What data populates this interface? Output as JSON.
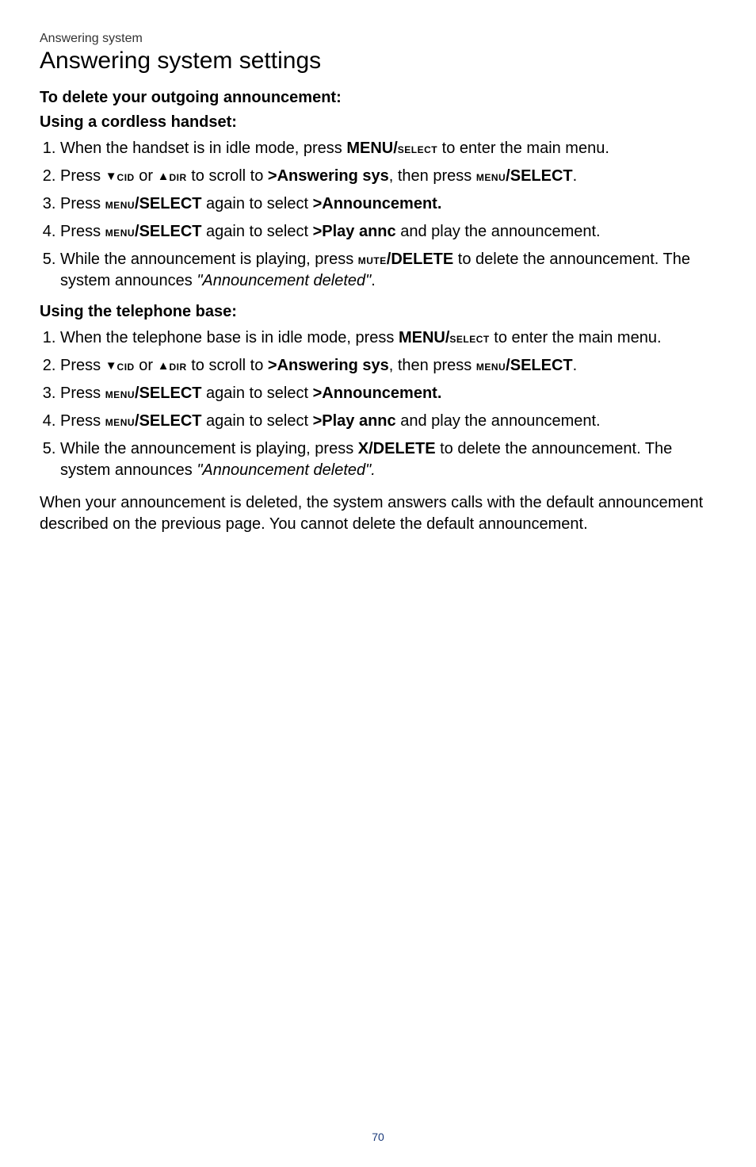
{
  "breadcrumb": "Answering system",
  "title": "Answering system settings",
  "heading1": "To delete your outgoing announcement:",
  "sub1": "Using a cordless handset:",
  "list1": {
    "i1a": "When the handset is in idle mode, press ",
    "i1b": "MENU/",
    "i1c": "select",
    "i1d": " to enter the main menu.",
    "i2a": "Press ",
    "i2b": "cid",
    "i2c": " or ",
    "i2d": "dir",
    "i2e": " to scroll to ",
    "i2f": ">Answering sys",
    "i2g": ", then press ",
    "i2h": "menu",
    "i2i": "/SELECT",
    "i2j": ".",
    "i3a": "Press ",
    "i3b": "menu",
    "i3c": "/SELECT",
    "i3d": " again to select ",
    "i3e": ">Announcement.",
    "i4a": "Press ",
    "i4b": "menu",
    "i4c": "/SELECT",
    "i4d": " again to select ",
    "i4e": ">Play annc",
    "i4f": " and play the announcement.",
    "i5a": "While the announcement is playing, press ",
    "i5b": "mute",
    "i5c": "/DELETE",
    "i5d": " to delete the announcement. The system announces ",
    "i5e": "\"Announcement deleted\"",
    "i5f": "."
  },
  "sub2": "Using the telephone base:",
  "list2": {
    "i1a": "When the telephone base is in idle mode, press ",
    "i1b": "MENU/",
    "i1c": "select",
    "i1d": " to enter the main menu.",
    "i2a": "Press ",
    "i2b": "cid",
    "i2c": " or ",
    "i2d": "dir",
    "i2e": " to scroll to ",
    "i2f": ">Answering sys",
    "i2g": ", then press ",
    "i2h": "menu",
    "i2i": "/SELECT",
    "i2j": ".",
    "i3a": "Press ",
    "i3b": "menu",
    "i3c": "/SELECT",
    "i3d": " again to select ",
    "i3e": ">Announcement.",
    "i4a": "Press ",
    "i4b": "menu",
    "i4c": "/SELECT",
    "i4d": " again to select ",
    "i4e": ">Play annc",
    "i4f": " and play the announcement.",
    "i5a": "While the announcement is playing, press ",
    "i5b": "X/DELETE",
    "i5c": " to delete the announcement. The system announces ",
    "i5d": "\"Announcement deleted\".",
    "i5e": ""
  },
  "closing": "When your announcement is deleted, the system answers calls with the default announcement described on the previous page. You cannot delete the default announcement.",
  "pageNumber": "70",
  "glyphs": {
    "triDown": "▼",
    "triUp": "▲"
  }
}
